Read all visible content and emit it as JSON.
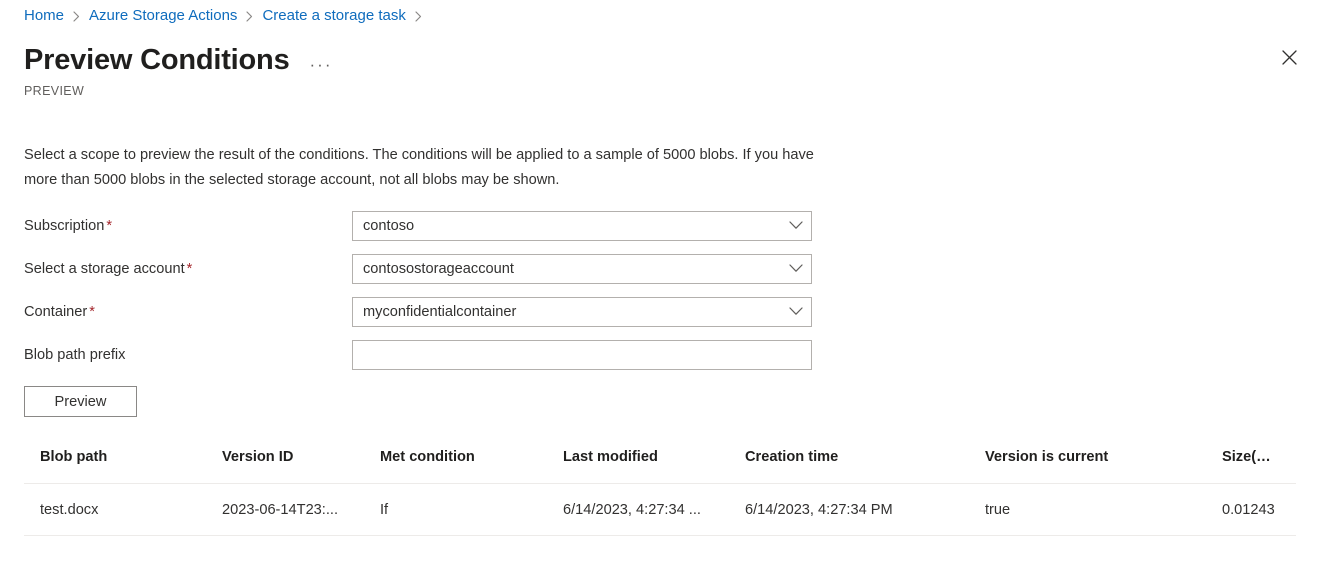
{
  "breadcrumb": {
    "items": [
      {
        "label": "Home"
      },
      {
        "label": "Azure Storage Actions"
      },
      {
        "label": "Create a storage task"
      }
    ],
    "trailing_separator": true
  },
  "header": {
    "title": "Preview Conditions",
    "overflow_menu_label": "···",
    "subtitle": "PREVIEW",
    "close_label": "Close",
    "accent_color": "#0f6cbd",
    "required_color": "#a4262c"
  },
  "description": "Select a scope to preview the result of the conditions. The conditions will be applied to a sample of 5000 blobs. If you have more than 5000 blobs in the selected storage account, not all blobs may be shown.",
  "form": {
    "fields": [
      {
        "label": "Subscription",
        "required": true,
        "type": "dropdown",
        "value": "contoso",
        "placeholder": ""
      },
      {
        "label": "Select a storage account",
        "required": true,
        "type": "dropdown",
        "value": "contosostorageaccount",
        "placeholder": ""
      },
      {
        "label": "Container",
        "required": true,
        "type": "dropdown",
        "value": "myconfidentialcontainer",
        "placeholder": ""
      },
      {
        "label": "Blob path prefix",
        "required": false,
        "type": "text",
        "value": "",
        "placeholder": ""
      }
    ],
    "preview_button_label": "Preview"
  },
  "results": {
    "columns": [
      "Blob path",
      "Version ID",
      "Met condition",
      "Last modified",
      "Creation time",
      "Version is current",
      "Size(MB)"
    ],
    "rows": [
      {
        "blob_path": "test.docx",
        "version_id": "2023-06-14T23:...",
        "met_condition": "If",
        "last_modified": "6/14/2023, 4:27:34 ...",
        "creation_time": "6/14/2023, 4:27:34 PM",
        "version_is_current": "true",
        "size_mb": "0.01243"
      }
    ]
  }
}
